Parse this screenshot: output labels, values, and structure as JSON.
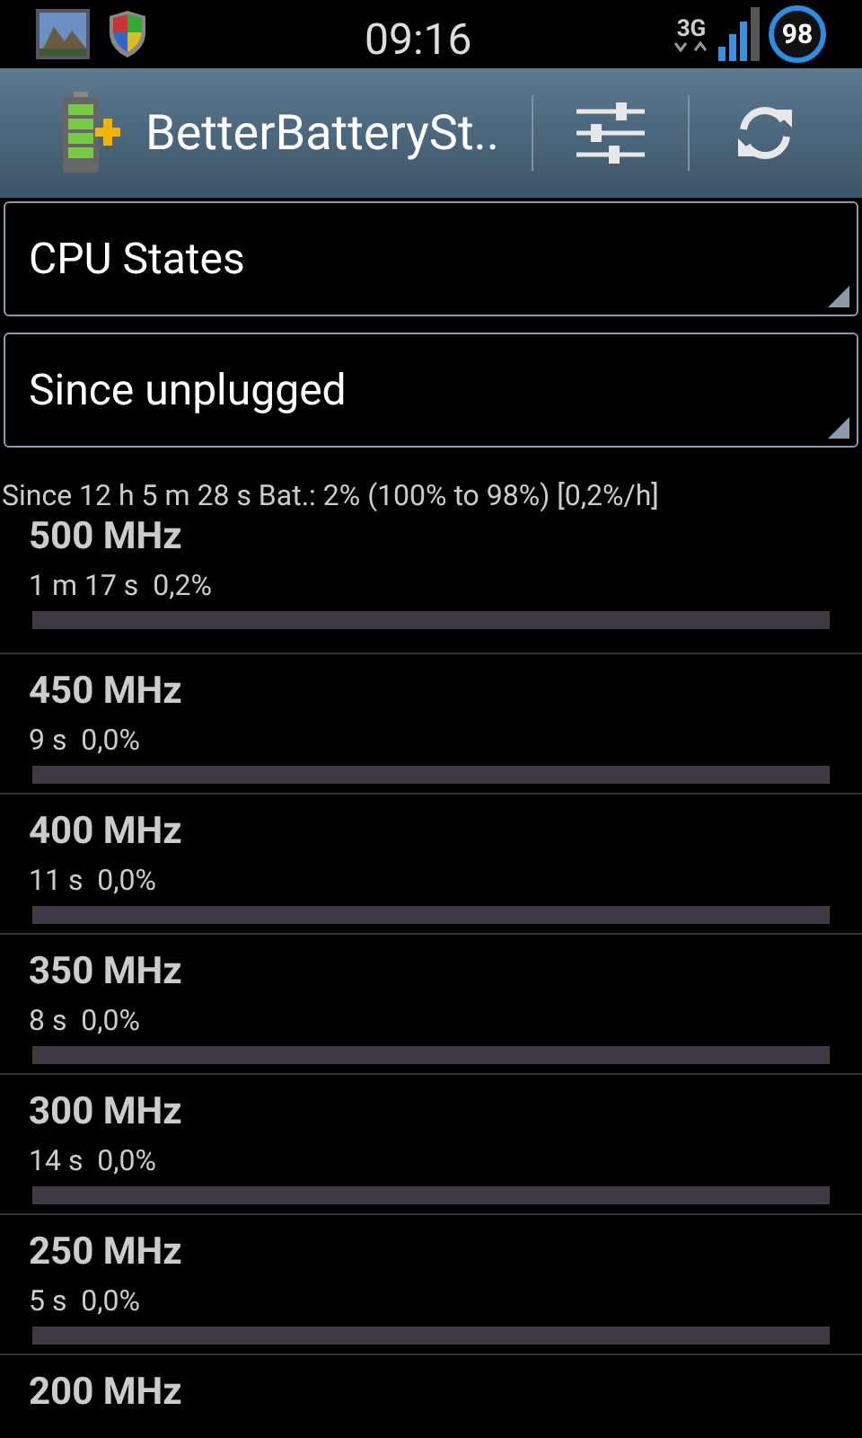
{
  "status_bar": {
    "time": "09:16",
    "network": "3G",
    "battery": "98"
  },
  "action_bar": {
    "title": "BetterBatterySt.."
  },
  "spinners": [
    {
      "value": "CPU States"
    },
    {
      "value": "Since unplugged"
    }
  ],
  "summary": "Since 12 h 5 m 28 s  Bat.: 2% (100% to 98%) [0,2%/h]",
  "states": [
    {
      "name": "500 MHz",
      "detail": "1 m 17 s  0,2%"
    },
    {
      "name": "450 MHz",
      "detail": "9 s  0,0%"
    },
    {
      "name": "400 MHz",
      "detail": "11 s  0,0%"
    },
    {
      "name": "350 MHz",
      "detail": "8 s  0,0%"
    },
    {
      "name": "300 MHz",
      "detail": "14 s  0,0%"
    },
    {
      "name": "250 MHz",
      "detail": "5 s  0,0%"
    },
    {
      "name": "200 MHz"
    }
  ]
}
